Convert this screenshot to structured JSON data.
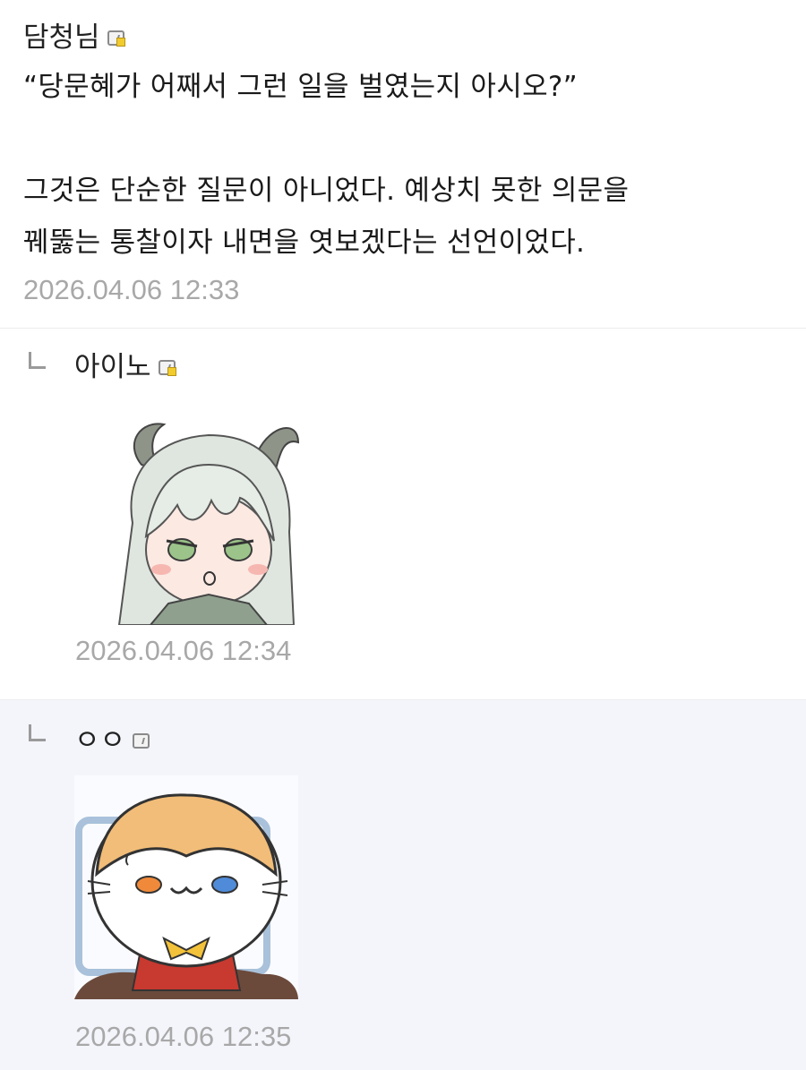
{
  "post": {
    "author": "담청님",
    "lines": [
      "“당문혜가 어째서 그런 일을 벌였는지 아시오?”",
      "그것은 단순한 질문이 아니었다. 예상치 못한 의문을",
      "꿰뚫는 통찰이자 내면을 엿보겠다는 선언이었다."
    ],
    "timestamp": "2026.04.06 12:33"
  },
  "replies": [
    {
      "author": "아이노",
      "sticker": "anime-girl-sticker",
      "timestamp": "2026.04.06 12:34"
    },
    {
      "author": "ㅇㅇ",
      "sticker": "cat-sticker",
      "timestamp": "2026.04.06 12:35"
    }
  ],
  "colors": {
    "timestamp": "#a8a8a8",
    "highlight_row": "#f4f5fb",
    "badge_dot": "#f1cc2c"
  },
  "icons": {
    "member_badge": "member-badge-icon",
    "reply": "reply-arrow-icon"
  }
}
